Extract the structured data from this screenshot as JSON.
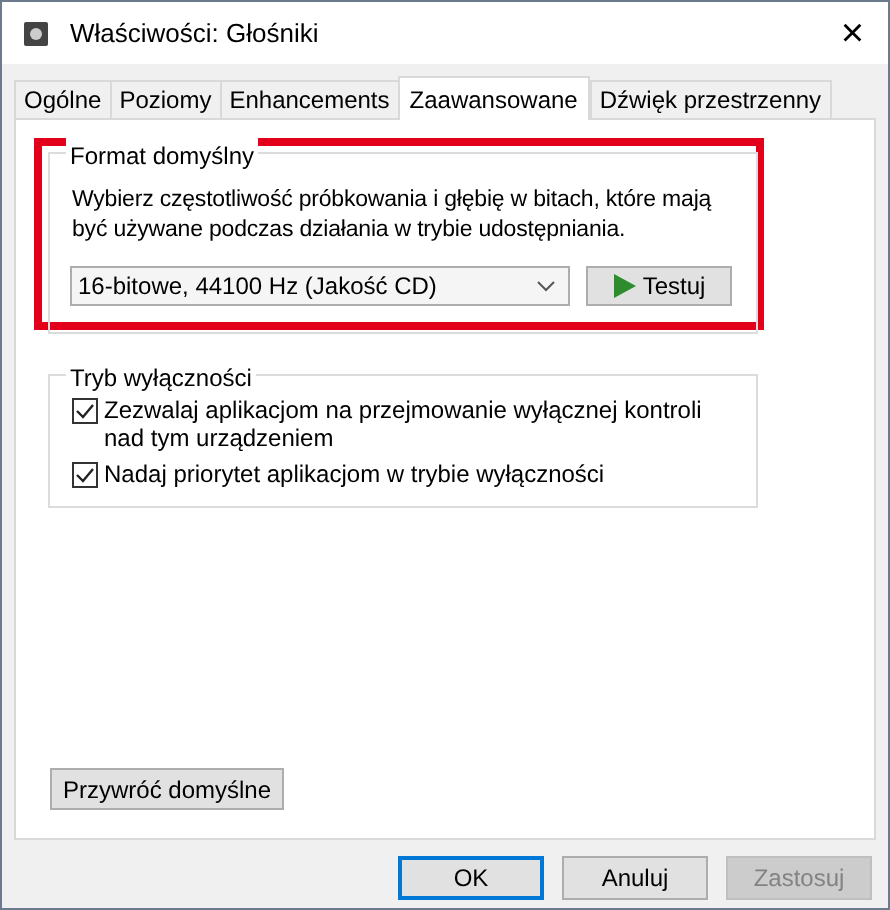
{
  "window": {
    "title": "Właściwości: Głośniki",
    "close": "×"
  },
  "tabs": [
    {
      "label": "Ogólne",
      "selected": false
    },
    {
      "label": "Poziomy",
      "selected": false
    },
    {
      "label": "Enhancements",
      "selected": false
    },
    {
      "label": "Zaawansowane",
      "selected": true
    },
    {
      "label": "Dźwięk przestrzenny",
      "selected": false
    }
  ],
  "default_format": {
    "title": "Format domyślny",
    "highlighted": true,
    "description": "Wybierz częstotliwość próbkowania i głębię w bitach, które mają być używane podczas działania w trybie udostępniania.",
    "format_value": "16-bitowe, 44100 Hz (Jakość CD)",
    "test_button": "Testuj"
  },
  "exclusive_mode": {
    "title": "Tryb wyłączności",
    "options": [
      {
        "label": "Zezwalaj aplikacjom na przejmowanie wyłącznej kontroli nad tym urządzeniem",
        "checked": true
      },
      {
        "label": "Nadaj priorytet aplikacjom w trybie wyłączności",
        "checked": true
      }
    ]
  },
  "restore_button": "Przywróć domyślne",
  "buttons": [
    {
      "label": "OK",
      "default": true,
      "disabled": false
    },
    {
      "label": "Anuluj",
      "default": false,
      "disabled": false
    },
    {
      "label": "Zastosuj",
      "default": false,
      "disabled": true
    }
  ]
}
